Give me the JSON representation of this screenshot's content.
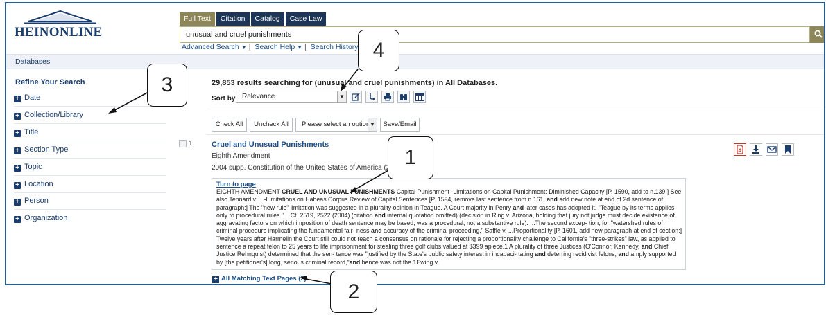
{
  "header": {
    "logo_text": "HEINONLINE",
    "tabs": [
      {
        "label": "Full Text",
        "active": true
      },
      {
        "label": "Citation",
        "active": false
      },
      {
        "label": "Catalog",
        "active": false
      },
      {
        "label": "Case Law",
        "active": false
      }
    ],
    "search_value": "unusual and cruel punishments",
    "search_placeholder": "",
    "links": [
      "Advanced Search",
      "Search Help",
      "Search History"
    ]
  },
  "databases_label": "Databases",
  "refine": {
    "title": "Refine Your Search",
    "facets": [
      "Date",
      "Collection/Library",
      "Title",
      "Section Type",
      "Topic",
      "Location",
      "Person",
      "Organization"
    ]
  },
  "results": {
    "count_prefix": "29,853 results searching for (",
    "query": "unusual and cruel punishments",
    "count_suffix": ") in All Databases.",
    "sort_label": "Sort by:",
    "sort_value": "Relevance"
  },
  "actions": {
    "check_all": "Check All",
    "uncheck_all": "Uncheck All",
    "option_select": "Please select an option",
    "save_email": "Save/Email"
  },
  "result": {
    "number": "1.",
    "title": "Cruel and Unusual Punishments",
    "subtitle": "Eighth Amendment",
    "source": "2004 supp. Constitution of the United States of America (2004)",
    "turn_to_page": "Turn to page",
    "snippet": [
      {
        "t": "EIGHTH AMENDMENT "
      },
      {
        "t": "CRUEL AND UNUSUAL PUNISHMENTS",
        "b": true
      },
      {
        "t": " Capital Punishment -Limitations on Capital Punishment: Diminished Capacity [P. 1590, add to n.139:] See also Tennard v. ...-Limitations on Habeas Corpus Review of Capital Sentences [P. 1594, remove last sentence from n.161, "
      },
      {
        "t": "and",
        "b": true
      },
      {
        "t": " add new note at end of 2d sentence of paragraph:] The \"new rule\" limitation was suggested in a plurality opinion in Teague. A Court majority in Penry "
      },
      {
        "t": "and",
        "b": true
      },
      {
        "t": " later cases has adopted it. \"Teague by its terms applies only to procedural rules.\" ...Ct. 2519, 2522 (2004) (citation "
      },
      {
        "t": "and",
        "b": true
      },
      {
        "t": " internal quotation omitted) (decision in Ring v. Arizona, holding that jury not judge must decide existence of aggravating factors on which imposition of death sentence may be based, was a procedural, not a substantive rule). ...The second excep- tion, for \"watershed rules of criminal procedure implicating the fundamental fair- ness "
      },
      {
        "t": "and",
        "b": true
      },
      {
        "t": " accuracy of the criminal proceeding,\" Saffle v. ...Proportionality [P. 1601, add new paragraph at end of section:] Twelve years after Harmelin the Court still could not reach a consensus on rationale for rejecting a proportionality challenge to California's \"three-strikes\" law, as applied to sentence a repeat felon to 25 years to life imprisonment for stealing three golf clubs valued at $399 apiece.1 A plurality of three Justices (O'Connor, Kennedy, "
      },
      {
        "t": "and",
        "b": true
      },
      {
        "t": " Chief Justice Rehnquist) determined that the sen- tence was \"justified by the State's public safety interest in incapaci- tating "
      },
      {
        "t": "and",
        "b": true
      },
      {
        "t": " deterring recidivist felons, "
      },
      {
        "t": "and",
        "b": true
      },
      {
        "t": " amply supported by [the petitioner's] long, serious criminal record,\""
      },
      {
        "t": "and",
        "b": true
      },
      {
        "t": " hence was not the 1Ewing v."
      }
    ],
    "all_matching": "All Matching Text Pages (2)"
  },
  "callouts": [
    "1",
    "2",
    "3",
    "4"
  ],
  "colors": {
    "navy": "#1d3557",
    "olive": "#8c8658",
    "link": "#1a4f8a",
    "pdf_red": "#c0392b"
  },
  "icons": {
    "search": "magnifier-icon",
    "toolbar": [
      "edit-icon",
      "sort-direction-icon",
      "print-icon",
      "binoculars-icon",
      "columns-icon"
    ],
    "result_actions": [
      "pdf-icon",
      "download-icon",
      "email-icon",
      "bookmark-icon"
    ]
  }
}
